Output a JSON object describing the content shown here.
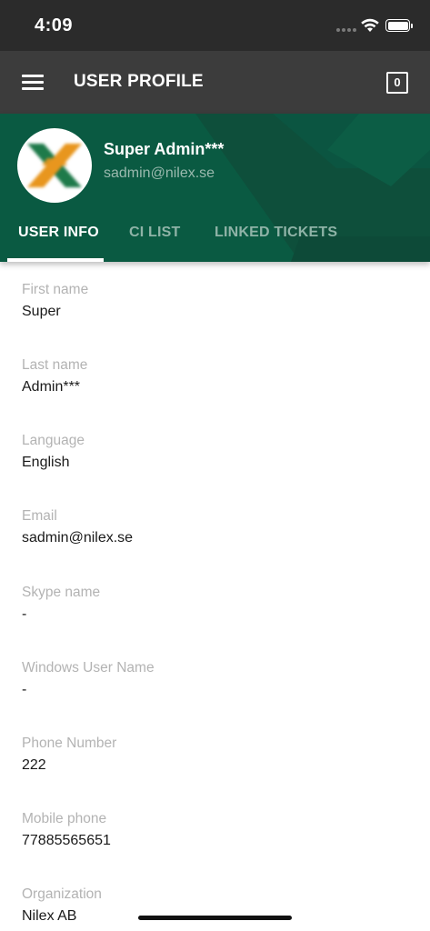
{
  "status_bar": {
    "time": "4:09"
  },
  "app_bar": {
    "title": "USER PROFILE",
    "cart_count": "0"
  },
  "profile": {
    "name": "Super Admin***",
    "email": "sadmin@nilex.se"
  },
  "tabs": [
    {
      "label": "USER INFO",
      "active": true
    },
    {
      "label": "CI LIST",
      "active": false
    },
    {
      "label": "LINKED TICKETS",
      "active": false
    }
  ],
  "fields": [
    {
      "label": "First name",
      "value": "Super"
    },
    {
      "label": "Last name",
      "value": "Admin***"
    },
    {
      "label": "Language",
      "value": "English"
    },
    {
      "label": "Email",
      "value": "sadmin@nilex.se"
    },
    {
      "label": "Skype name",
      "value": "-"
    },
    {
      "label": "Windows User Name",
      "value": "-"
    },
    {
      "label": "Phone Number",
      "value": "222"
    },
    {
      "label": "Mobile phone",
      "value": "77885565651"
    },
    {
      "label": "Organization",
      "value": "Nilex AB"
    }
  ],
  "colors": {
    "status_bar": "#2b2b2b",
    "app_bar": "#3c3c3c",
    "header_green": "#0a5a42",
    "logo_orange": "#e8961e",
    "logo_green": "#1e7a4a"
  }
}
